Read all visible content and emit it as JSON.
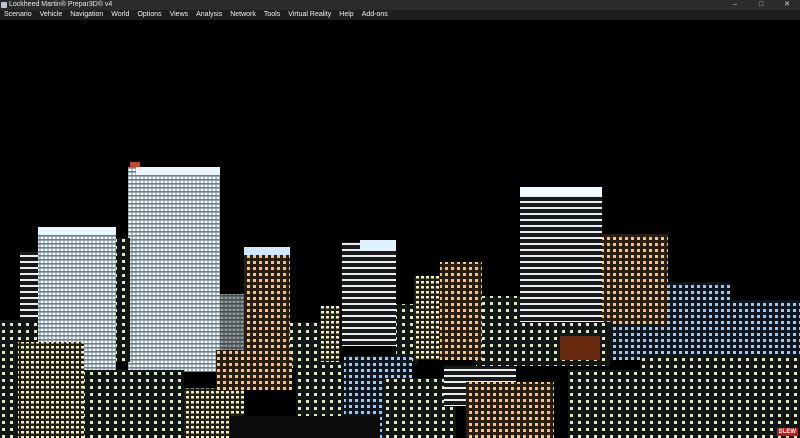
{
  "window": {
    "title": "Lockheed Martin® Prepar3D® v4",
    "controls": {
      "minimize": "–",
      "maximize": "□",
      "close": "✕"
    }
  },
  "menu": [
    "Scenario",
    "Vehicle",
    "Navigation",
    "World",
    "Options",
    "Views",
    "Analysis",
    "Network",
    "Tools",
    "Virtual Reality",
    "Help",
    "Add-ons"
  ],
  "status": {
    "slew_badge": "SLEW"
  },
  "colors": {
    "sky": "#000000",
    "titlebar": "#2b2b2b",
    "menubar": "#1e1e1e",
    "badge": "#c41a1a"
  }
}
